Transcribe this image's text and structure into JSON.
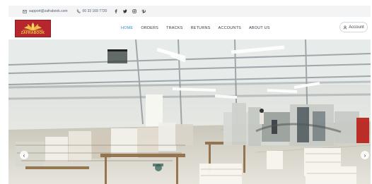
{
  "topbar": {
    "email": "support@zafrabook.com",
    "phone": "00 33 169 7720",
    "social_icons": [
      "facebook-icon",
      "twitter-icon",
      "instagram-icon",
      "pinterest-icon"
    ]
  },
  "header": {
    "logo_text": "ZAFRABOOK",
    "nav_items": [
      "HOME",
      "ORDERS",
      "TRACKS",
      "RETURNS",
      "ACCOUNTS",
      "ABOUT US"
    ],
    "active_nav": "HOME",
    "account_label": "Account"
  },
  "hero": {
    "image_subject": "warehouse with printing machines and stacks of paper",
    "left_icon": "arrow-left-icon",
    "right_icon": "arrow-right-icon"
  },
  "colors": {
    "accent": "#2f8fc7",
    "logo_background": "#b5262d",
    "logo_text": "#f0c84a"
  }
}
